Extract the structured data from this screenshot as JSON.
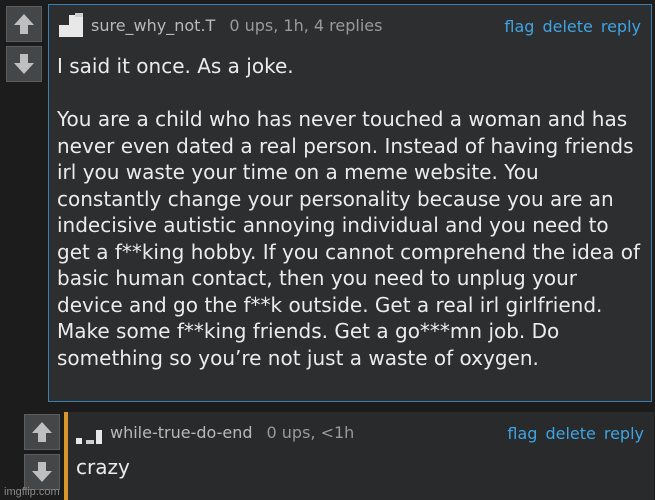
{
  "comment1": {
    "username": "sure_why_not.T",
    "meta": "0 ups, 1h, 4 replies",
    "actions": {
      "flag": "flag",
      "delete": "delete",
      "reply": "reply"
    },
    "body": "I said it once. As a joke.\n\nYou are a child who has never touched a woman and has never even dated a real person. Instead of having friends irl you waste your time on a meme website. You constantly change your personality because you are an indecisive autistic annoying individual and you need to get a f**king hobby. If you cannot comprehend the idea of basic human contact, then you need to unplug your device and go the f**k outside. Get a real irl girlfriend. Make some f**king friends. Get a go***mn job. Do something so you’re not just a waste of oxygen."
  },
  "comment2": {
    "username": "while-true-do-end",
    "meta": "0 ups, <1h",
    "actions": {
      "flag": "flag",
      "delete": "delete",
      "reply": "reply"
    },
    "body": "crazy"
  },
  "watermark": "imgflip.com",
  "icons": {
    "upvote": "up-arrow-icon",
    "downvote": "down-arrow-icon"
  },
  "colors": {
    "link": "#3fa4e3",
    "reply_accent": "#d9962b",
    "border": "#3a7fb0"
  }
}
